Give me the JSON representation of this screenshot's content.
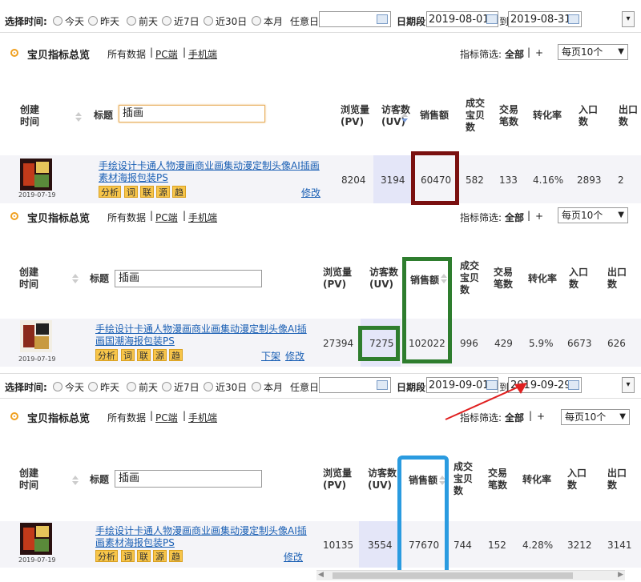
{
  "filter_top": {
    "label": "选择时间:",
    "options": [
      "今天",
      "昨天",
      "前天",
      "近7日",
      "近30日",
      "本月",
      "任意日"
    ],
    "range_label": "日期段",
    "to_label": "到",
    "start": "2019-08-01",
    "end": "2019-08-31",
    "collapse_icon": "chevron-down-icon"
  },
  "filter_bottom": {
    "label": "选择时间:",
    "options": [
      "今天",
      "昨天",
      "前天",
      "近7日",
      "近30日",
      "本月",
      "任意日"
    ],
    "range_label": "日期段",
    "to_label": "到",
    "start": "2019-09-01",
    "end": "2019-09-29"
  },
  "panel_header": {
    "title": "宝贝指标总览",
    "links": [
      "所有数据",
      "PC端",
      "手机端"
    ],
    "separator": "|",
    "metric_filter_label": "指标筛选:",
    "metric_filter_value": "全部",
    "plus": "+",
    "page_size": "每页10个"
  },
  "columns": {
    "created": "创建时间",
    "title": "标题",
    "pv": "浏览量(PV)",
    "uv": "访客数(UV)",
    "sales": "销售额",
    "orders": "成交宝贝数",
    "trans": "交易笔数",
    "conv": "转化率",
    "entry": "入口数",
    "exit": "出口数"
  },
  "search_keyword": "插画",
  "tags": [
    "分析",
    "词",
    "联",
    "源",
    "趋"
  ],
  "actions": {
    "edit": "修改",
    "take_down": "下架"
  },
  "panels": [
    {
      "product_title": "手绘设计卡通人物漫画商业画集动漫定制头像AI插画素材海报包装PS",
      "date": "2019-07-19",
      "pv": "8204",
      "uv": "3194",
      "sales": "60470",
      "orders": "582",
      "trans": "133",
      "conv": "4.16%",
      "entry": "2893",
      "exit": "2",
      "highlight_color": "#7a1010"
    },
    {
      "product_title": "手绘设计卡通人物漫画商业画集动漫定制头像AI插画国潮海报包装PS",
      "date": "2019-07-19",
      "pv": "27394",
      "uv": "7275",
      "sales": "102022",
      "orders": "996",
      "trans": "429",
      "conv": "5.9%",
      "entry": "6673",
      "exit": "626",
      "highlight_color": "#2e7d2e"
    },
    {
      "product_title": "手绘设计卡通人物漫画商业画集动漫定制头像AI插画素材海报包装PS",
      "date": "2019-07-19",
      "pv": "10135",
      "uv": "3554",
      "sales": "77670",
      "orders": "744",
      "trans": "152",
      "conv": "4.28%",
      "entry": "3212",
      "exit": "3141",
      "highlight_color": "#2a9be0"
    }
  ],
  "annotation_arrow_color": "#e02020"
}
